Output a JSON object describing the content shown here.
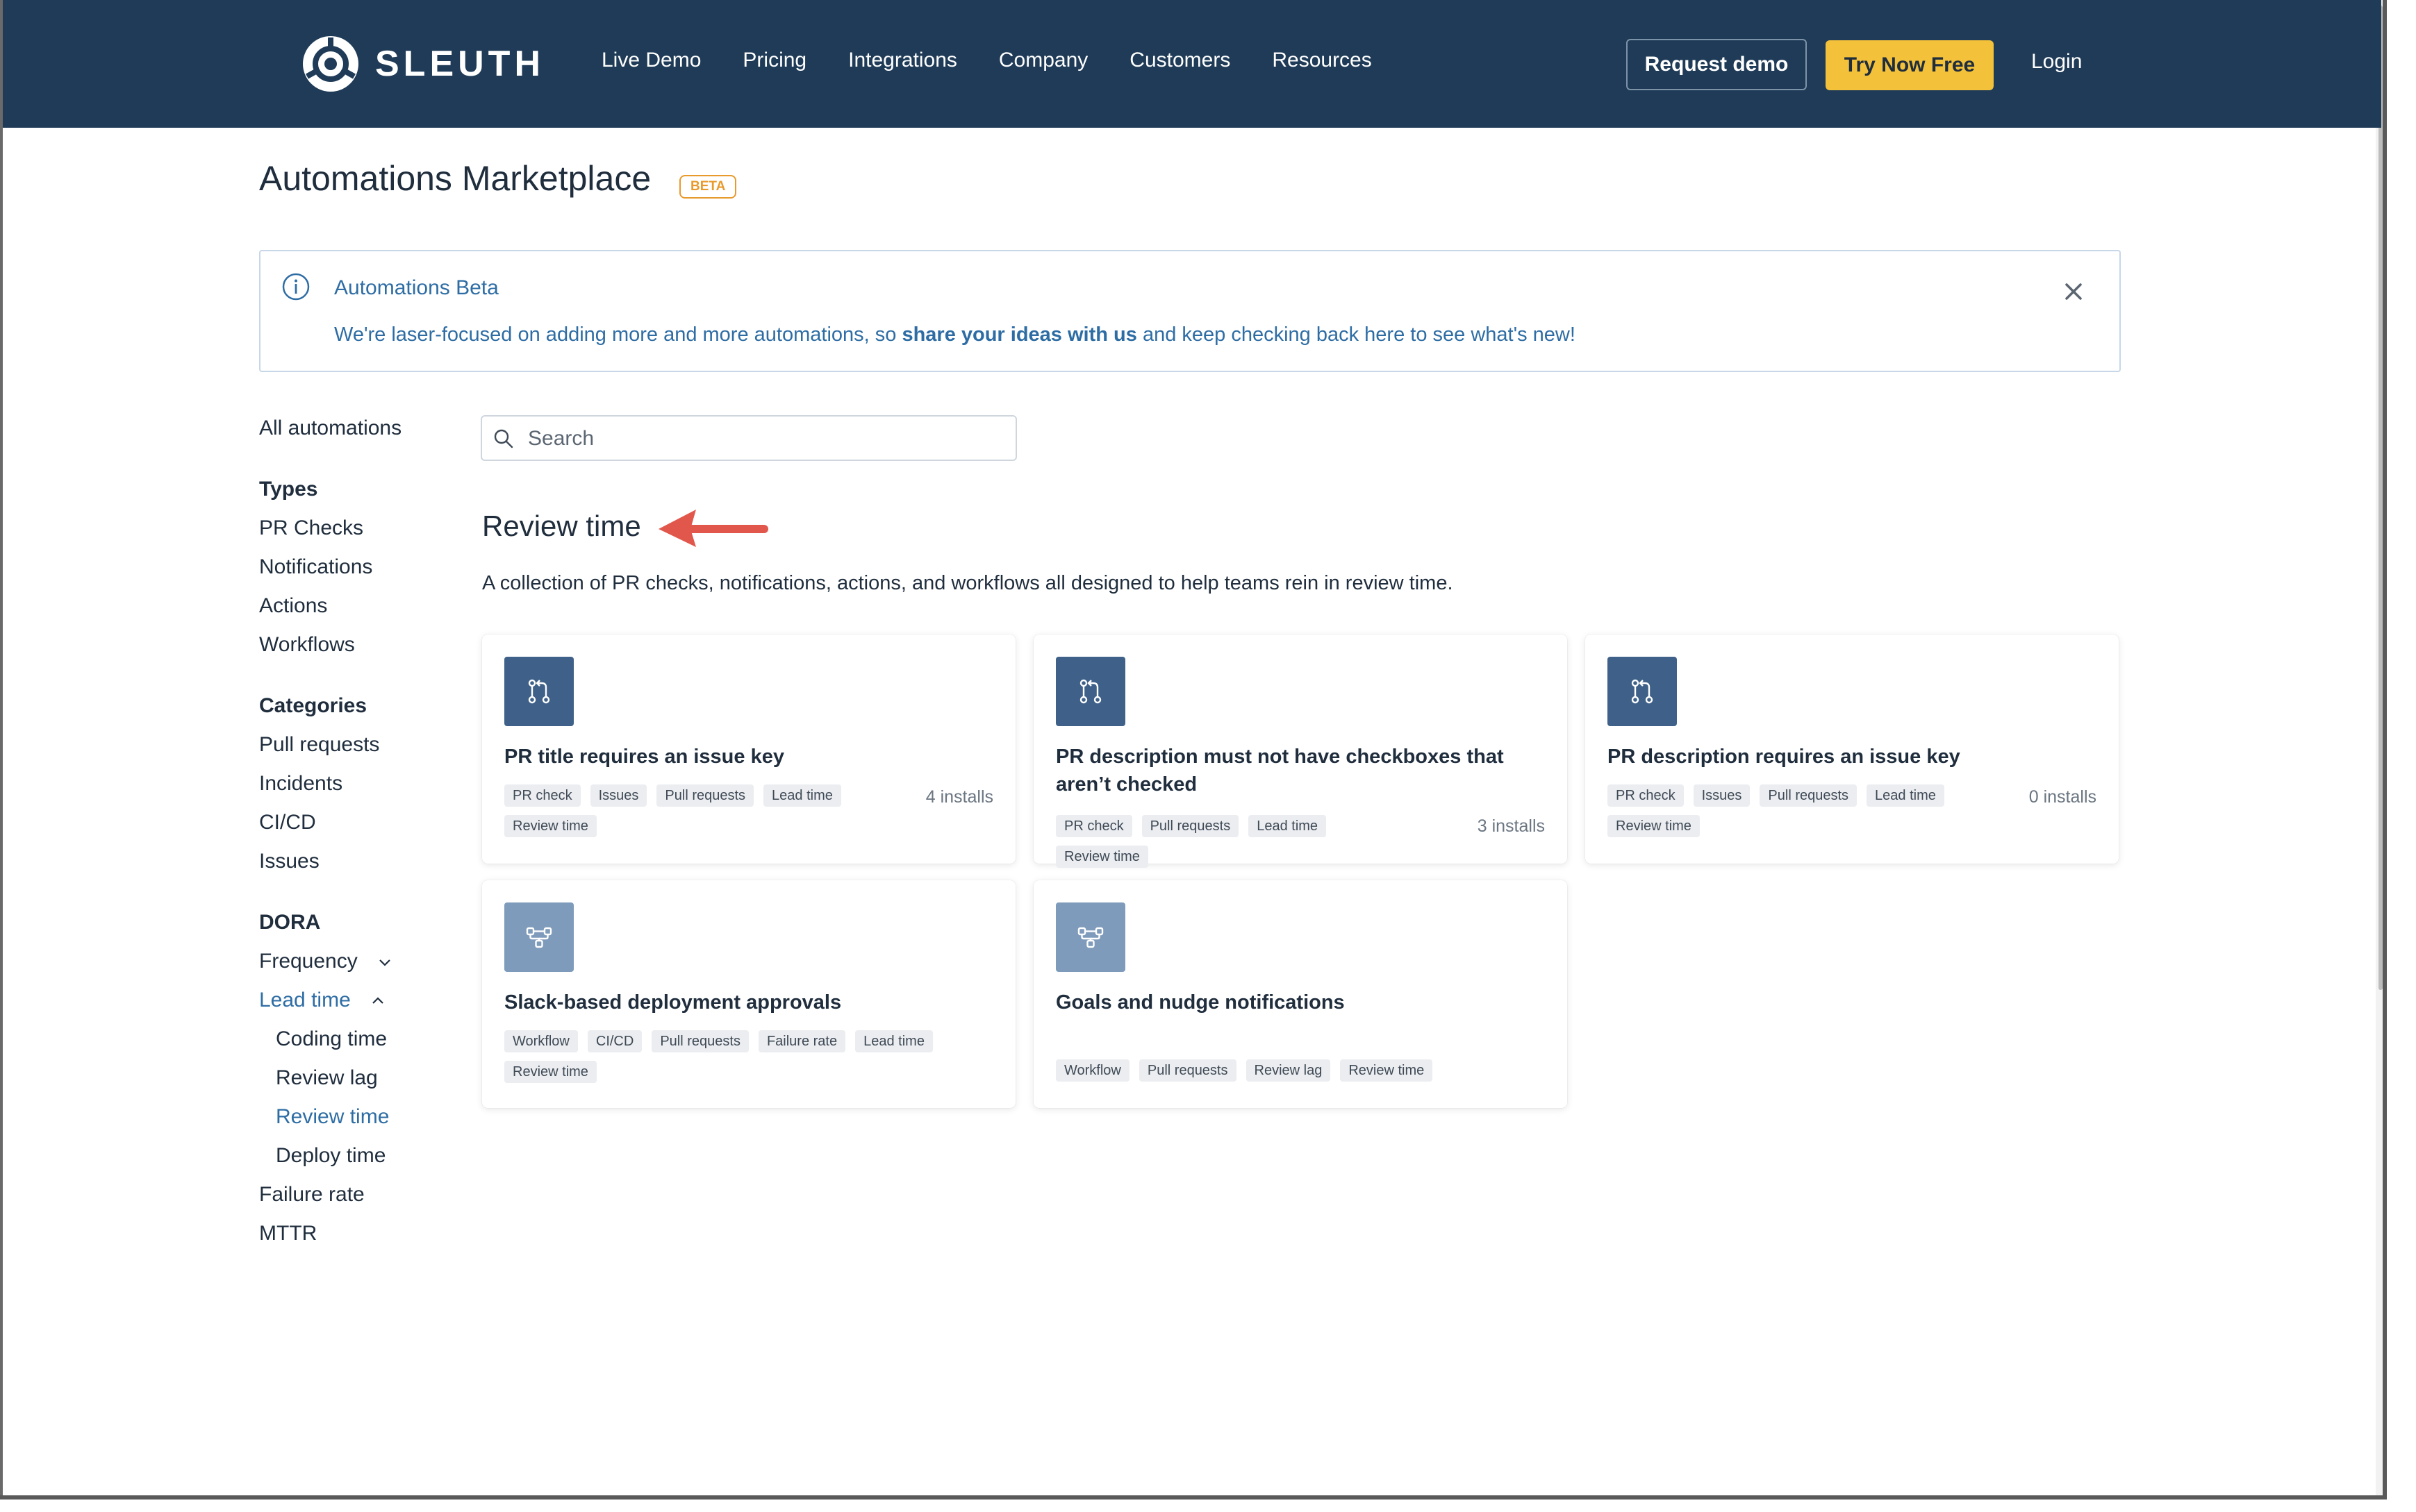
{
  "nav": {
    "logo_text": "SLEUTH",
    "links": [
      "Live Demo",
      "Pricing",
      "Integrations",
      "Company",
      "Customers",
      "Resources"
    ],
    "request_demo": "Request demo",
    "try_now": "Try Now Free",
    "login": "Login"
  },
  "page": {
    "title": "Automations Marketplace",
    "badge": "BETA"
  },
  "banner": {
    "title": "Automations Beta",
    "text_before": "We're laser-focused on adding more and more automations, so ",
    "text_link": "share your ideas with us",
    "text_after": " and keep checking back here to see what's new!"
  },
  "sidebar": {
    "all": "All automations",
    "types_heading": "Types",
    "types": [
      "PR Checks",
      "Notifications",
      "Actions",
      "Workflows"
    ],
    "categories_heading": "Categories",
    "categories": [
      "Pull requests",
      "Incidents",
      "CI/CD",
      "Issues"
    ],
    "dora_heading": "DORA",
    "dora": {
      "frequency": "Frequency",
      "lead_time": "Lead time",
      "lead_time_children": [
        "Coding time",
        "Review lag",
        "Review time",
        "Deploy time"
      ],
      "failure_rate": "Failure rate",
      "mttr": "MTTR"
    }
  },
  "search": {
    "placeholder": "Search",
    "value": ""
  },
  "section": {
    "title": "Review time",
    "description": "A collection of PR checks, notifications, actions, and workflows all designed to help teams rein in review time."
  },
  "cards": [
    {
      "icon": "pull-request-icon",
      "title": "PR title requires an issue key",
      "tags": [
        "PR check",
        "Issues",
        "Pull requests",
        "Lead time",
        "Review time"
      ],
      "installs": "4 installs"
    },
    {
      "icon": "pull-request-icon",
      "title": "PR description must not have checkboxes that aren’t checked",
      "tags": [
        "PR check",
        "Pull requests",
        "Lead time",
        "Review time"
      ],
      "installs": "3 installs"
    },
    {
      "icon": "pull-request-icon",
      "title": "PR description requires an issue key",
      "tags": [
        "PR check",
        "Issues",
        "Pull requests",
        "Lead time",
        "Review time"
      ],
      "installs": "0 installs"
    },
    {
      "icon": "workflow-icon",
      "title": "Slack-based deployment approvals",
      "tags": [
        "Workflow",
        "CI/CD",
        "Pull requests",
        "Failure rate",
        "Lead time",
        "Review time"
      ],
      "installs": ""
    },
    {
      "icon": "workflow-icon",
      "title": "Goals and nudge notifications",
      "tags": [
        "Workflow",
        "Pull requests",
        "Review lag",
        "Review time"
      ],
      "installs": ""
    }
  ],
  "colors": {
    "nav_bg": "#1f3b57",
    "accent_blue": "#2e6da4",
    "try_button": "#f3c13a",
    "beta_orange": "#e89a2c",
    "annotation_arrow": "#e2574c"
  }
}
